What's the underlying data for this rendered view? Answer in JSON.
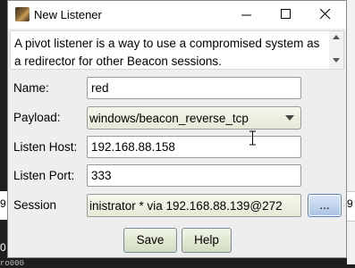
{
  "background": {
    "right_texts": [
      "9"
    ],
    "left_texts": [
      "9",
      "0",
      "ro000"
    ]
  },
  "window": {
    "title": "New Listener",
    "icon": "cobalt-strike-app-icon"
  },
  "description": "A pivot listener is a way to use a compromised system as a redirector for other Beacon sessions.",
  "form": {
    "name": {
      "label": "Name:",
      "value": "red"
    },
    "payload": {
      "label": "Payload:",
      "value": "windows/beacon_reverse_tcp"
    },
    "listen_host": {
      "label": "Listen Host:",
      "value": "192.168.88.158"
    },
    "listen_port": {
      "label": "Listen Port:",
      "value": "333"
    },
    "session": {
      "label": "Session",
      "value": "inistrator * via  192.168.88.139@272",
      "browse_label": "..."
    }
  },
  "buttons": {
    "save": "Save",
    "help": "Help"
  },
  "colors": {
    "accent": "#5a7fb8",
    "field_bg": "#ffffff",
    "window_bg": "#eeeeee"
  }
}
